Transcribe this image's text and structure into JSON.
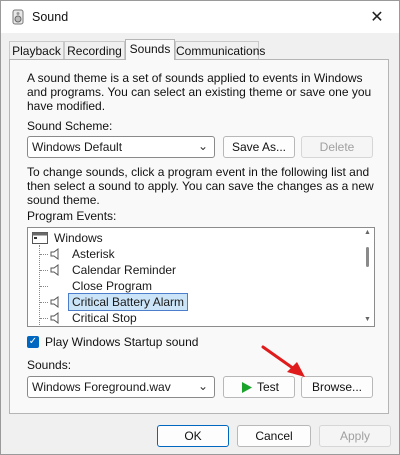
{
  "window": {
    "title": "Sound",
    "close_glyph": "✕"
  },
  "tabs": [
    {
      "label": "Playback"
    },
    {
      "label": "Recording"
    },
    {
      "label": "Sounds",
      "active": true
    },
    {
      "label": "Communications"
    }
  ],
  "sounds_tab": {
    "intro_line1": "A sound theme is a set of sounds applied to events in Windows",
    "intro_line2": "and programs.  You can select an existing theme or save one you",
    "intro_line3": "have modified.",
    "scheme_label": "Sound Scheme:",
    "scheme_value": "Windows Default",
    "save_as_label": "Save As...",
    "delete_label": "Delete",
    "instr_line1": "To change sounds, click a program event in the following list and",
    "instr_line2": "then select a sound to apply.  You can save the changes as a new",
    "instr_line3": "sound theme.",
    "events_label": "Program Events:",
    "events": {
      "root": "Windows",
      "items": [
        "Asterisk",
        "Calendar Reminder",
        "Close Program",
        "Critical Battery Alarm",
        "Critical Stop"
      ],
      "selected": "Critical Battery Alarm"
    },
    "startup_checkbox_label": "Play Windows Startup sound",
    "startup_checked": true,
    "sounds_label": "Sounds:",
    "sound_value": "Windows Foreground.wav",
    "test_label": "Test",
    "browse_label": "Browse..."
  },
  "footer": {
    "ok_label": "OK",
    "cancel_label": "Cancel",
    "apply_label": "Apply"
  },
  "colors": {
    "accent": "#0067c0",
    "annotation_arrow": "#e01b1b",
    "selection": "#cce4f7"
  }
}
